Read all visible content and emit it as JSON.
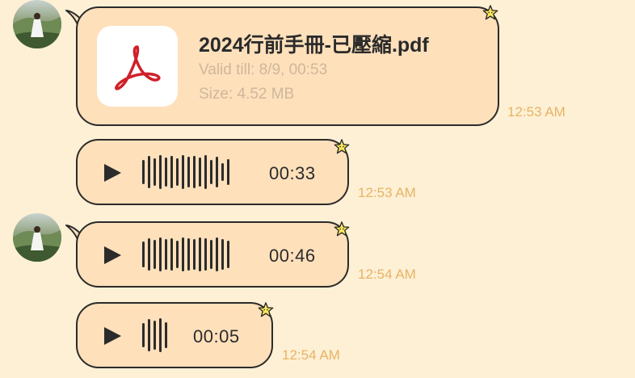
{
  "messages": [
    {
      "type": "file",
      "file_name": "2024行前手冊-已壓縮.pdf",
      "valid_till": "Valid till: 8/9, 00:53",
      "size": "Size: 4.52 MB",
      "time": "12:53 AM",
      "icon": "pdf-icon"
    },
    {
      "type": "voice",
      "duration": "00:33",
      "time": "12:53 AM"
    },
    {
      "type": "voice",
      "duration": "00:46",
      "time": "12:54 AM"
    },
    {
      "type": "voice",
      "duration": "00:05",
      "time": "12:54 AM"
    }
  ],
  "colors": {
    "background": "#fdf0d5",
    "bubble": "#fee0bb",
    "timestamp": "#e8b366",
    "pdf_red": "#d0202a"
  }
}
